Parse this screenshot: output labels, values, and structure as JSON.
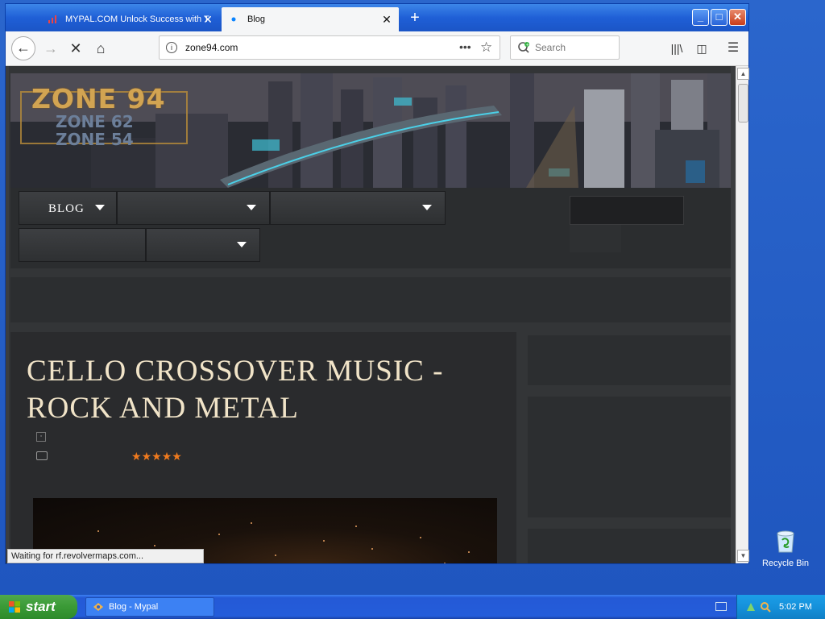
{
  "browser": {
    "tabs": [
      {
        "label": "MYPAL.COM Unlock Success with T"
      },
      {
        "label": "Blog"
      }
    ],
    "url": "zone94.com",
    "search_placeholder": "Search",
    "status": "Waiting for rf.revolvermaps.com..."
  },
  "site": {
    "logo_main": "ZONE 94",
    "logo_sub1": "ZONE 62",
    "logo_sub2": "ZONE 54",
    "menu": [
      {
        "label": "BLOG"
      }
    ],
    "post_title": "CELLO CROSSOVER MUSIC - ROCK AND METAL",
    "rating_stars": 5,
    "rating_max": 5
  },
  "desktop": {
    "recycle_bin": "Recycle Bin"
  },
  "taskbar": {
    "start": "start",
    "task": "Blog - Mypal",
    "clock": "5:02 PM"
  },
  "colors": {
    "title_text": "#f1e4c8",
    "star": "#ef7a1e",
    "logo_gold": "#d2a452"
  }
}
